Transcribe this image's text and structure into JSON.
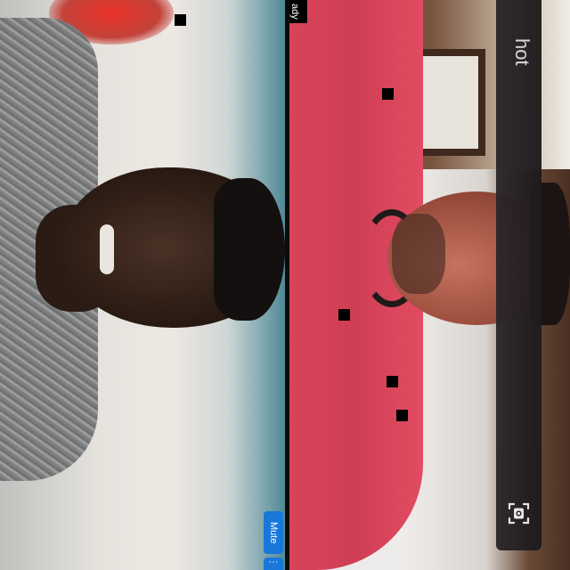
{
  "videos": {
    "left": {
      "label": ""
    },
    "right": {
      "name_tag": "ady"
    }
  },
  "screenshot_panel": {
    "title": "hot",
    "capture_icon": "screenshot-icon"
  },
  "controls": {
    "mute_label": "Mute",
    "more_label": "···"
  },
  "colors": {
    "accent_blue": "#1877d9",
    "panel_bg": "#1e1a1c",
    "divider": "#0b0b0b"
  }
}
